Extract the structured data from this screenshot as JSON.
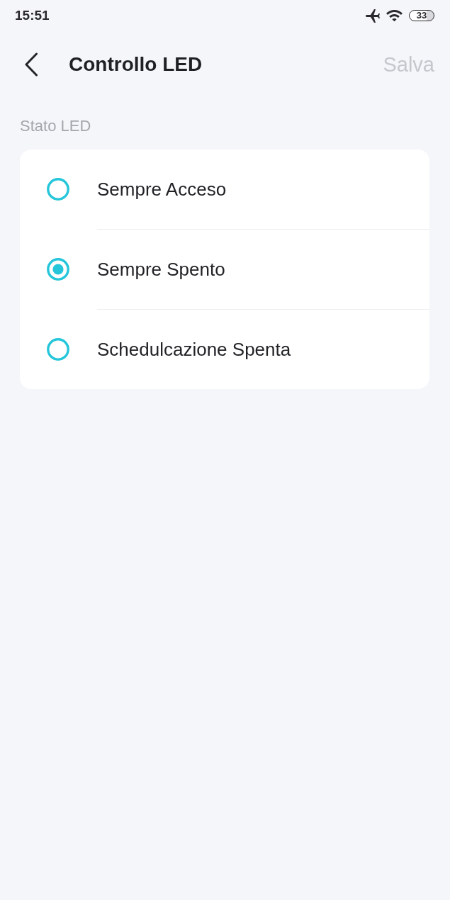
{
  "status_bar": {
    "time": "15:51",
    "battery": "33"
  },
  "header": {
    "title": "Controllo LED",
    "save": {
      "label": "Salva",
      "disabled": true
    }
  },
  "section": {
    "title": "Stato LED",
    "options": [
      {
        "label": "Sempre Acceso",
        "selected": false
      },
      {
        "label": "Sempre Spento",
        "selected": true
      },
      {
        "label": "Schedulcazione Spenta",
        "selected": false
      }
    ]
  }
}
